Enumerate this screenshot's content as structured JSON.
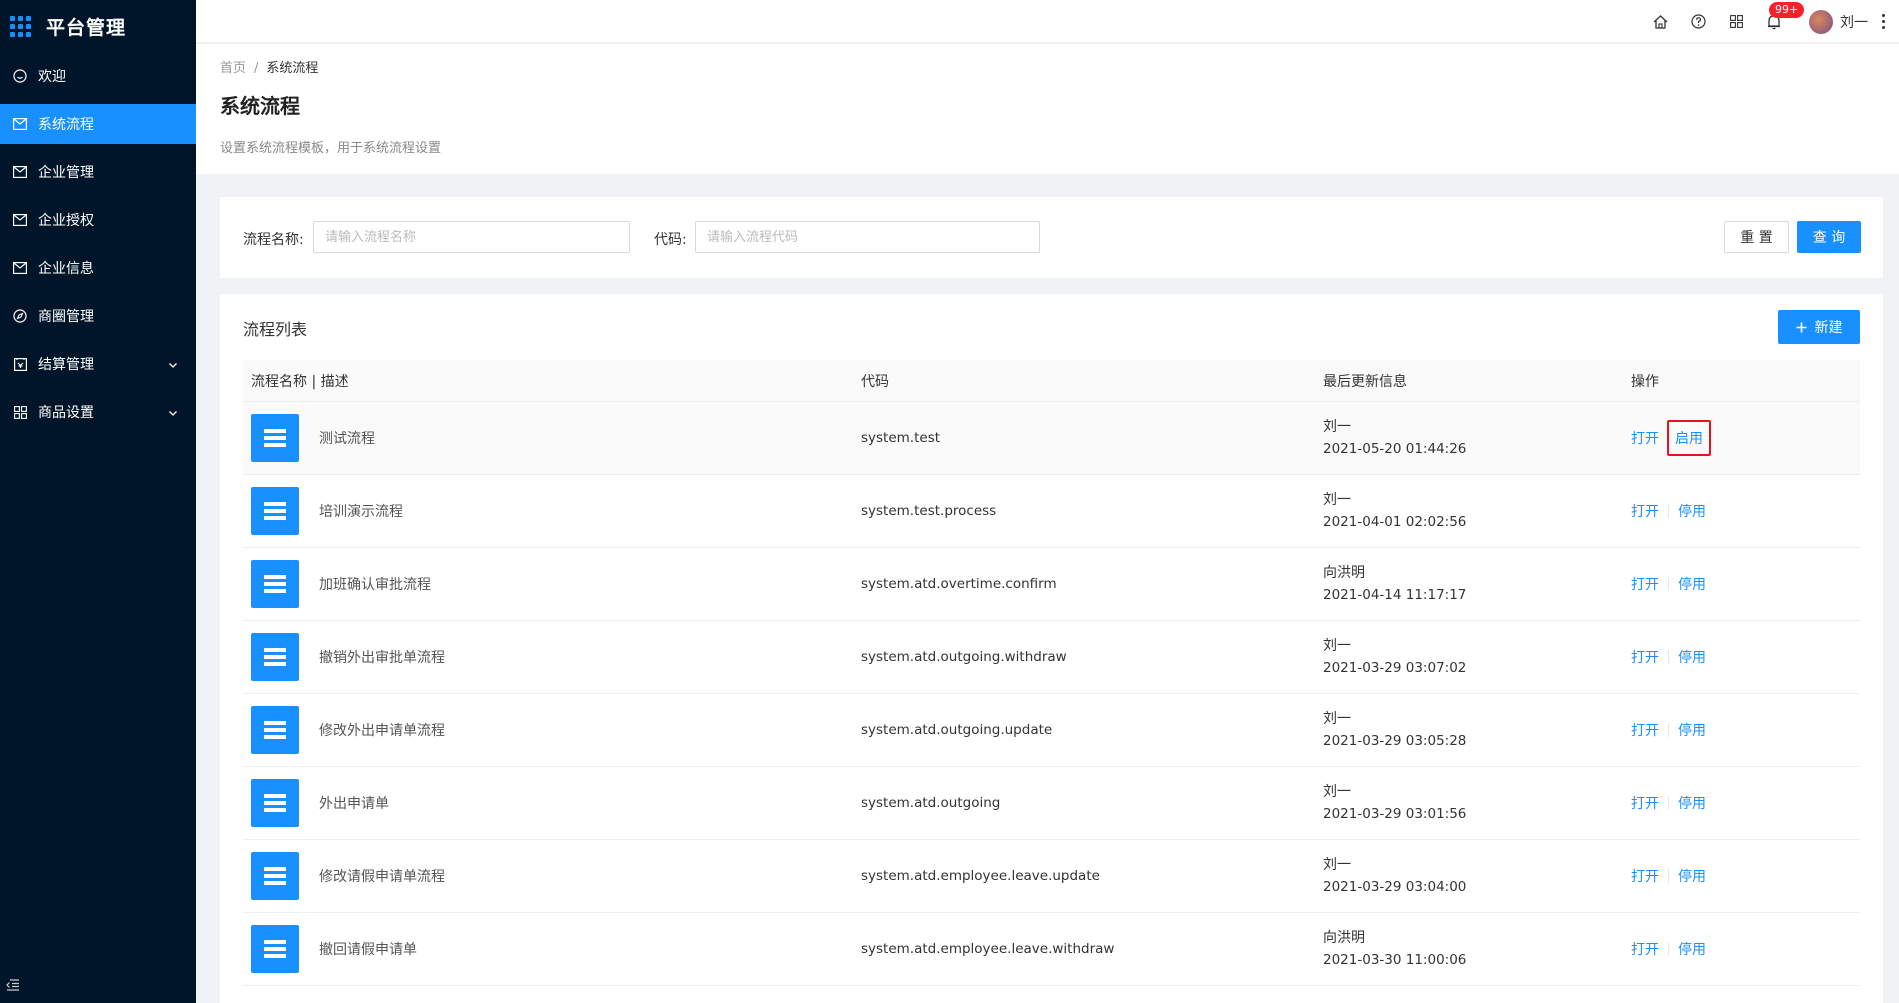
{
  "app": {
    "title": "平台管理"
  },
  "sidebar": {
    "items": [
      {
        "label": "欢迎",
        "icon": "smile-icon"
      },
      {
        "label": "系统流程",
        "icon": "mail-icon",
        "active": true
      },
      {
        "label": "企业管理",
        "icon": "mail-icon"
      },
      {
        "label": "企业授权",
        "icon": "mail-icon"
      },
      {
        "label": "企业信息",
        "icon": "mail-icon"
      },
      {
        "label": "商圈管理",
        "icon": "compass-icon"
      },
      {
        "label": "结算管理",
        "icon": "account-book-icon",
        "expandable": true
      },
      {
        "label": "商品设置",
        "icon": "appstore-icon",
        "expandable": true
      }
    ]
  },
  "header": {
    "notification_badge": "99+",
    "user_name": "刘一"
  },
  "page": {
    "breadcrumb": {
      "home": "首页",
      "current": "系统流程"
    },
    "title": "系统流程",
    "description": "设置系统流程模板，用于系统流程设置"
  },
  "search": {
    "name_label": "流程名称:",
    "name_placeholder": "请输入流程名称",
    "name_value": "",
    "code_label": "代码:",
    "code_placeholder": "请输入流程代码",
    "code_value": "",
    "reset_label": "重 置",
    "query_label": "查 询"
  },
  "list": {
    "title": "流程列表",
    "new_label": "新建",
    "columns": [
      "流程名称 | 描述",
      "代码",
      "最后更新信息",
      "操作"
    ],
    "open_label": "打开",
    "rows": [
      {
        "name": "测试流程",
        "code": "system.test",
        "user": "刘一",
        "time": "2021-05-20 01:44:26",
        "toggle": "启用"
      },
      {
        "name": "培训演示流程",
        "code": "system.test.process",
        "user": "刘一",
        "time": "2021-04-01 02:02:56",
        "toggle": "停用"
      },
      {
        "name": "加班确认审批流程",
        "code": "system.atd.overtime.confirm",
        "user": "向洪明",
        "time": "2021-04-14 11:17:17",
        "toggle": "停用"
      },
      {
        "name": "撤销外出审批单流程",
        "code": "system.atd.outgoing.withdraw",
        "user": "刘一",
        "time": "2021-03-29 03:07:02",
        "toggle": "停用"
      },
      {
        "name": "修改外出申请单流程",
        "code": "system.atd.outgoing.update",
        "user": "刘一",
        "time": "2021-03-29 03:05:28",
        "toggle": "停用"
      },
      {
        "name": "外出申请单",
        "code": "system.atd.outgoing",
        "user": "刘一",
        "time": "2021-03-29 03:01:56",
        "toggle": "停用"
      },
      {
        "name": "修改请假申请单流程",
        "code": "system.atd.employee.leave.update",
        "user": "刘一",
        "time": "2021-03-29 03:04:00",
        "toggle": "停用"
      },
      {
        "name": "撤回请假申请单",
        "code": "system.atd.employee.leave.withdraw",
        "user": "向洪明",
        "time": "2021-03-30 11:00:06",
        "toggle": "停用"
      }
    ]
  },
  "colors": {
    "primary": "#1890ff",
    "sidebar": "#001529",
    "highlight_box": "#e8141c"
  }
}
